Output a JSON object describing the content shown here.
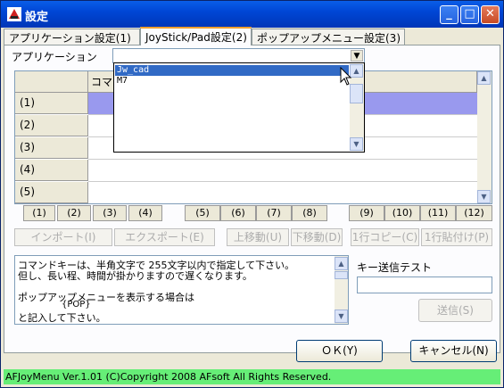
{
  "window": {
    "title": "設定",
    "minimize": "_",
    "maximize": "□",
    "close": "✕"
  },
  "tabs": [
    {
      "label": "アプリケーション設定(1)"
    },
    {
      "label": "JoyStick/Pad設定(2)"
    },
    {
      "label": "ポップアップメニュー設定(3)"
    }
  ],
  "app_label": "アプリケーション",
  "combo": {
    "value": "",
    "options": [
      "Jw_cad",
      "M7"
    ],
    "selected": "Jw_cad"
  },
  "grid": {
    "header": "コマ",
    "rows": [
      "(1)",
      "(2)",
      "(3)",
      "(4)",
      "(5)"
    ]
  },
  "key_buttons": [
    "(1)",
    "(2)",
    "(3)",
    "(4)",
    "(5)",
    "(6)",
    "(7)",
    "(8)",
    "(9)",
    "(10)",
    "(11)",
    "(12)"
  ],
  "action_buttons": [
    "インポート(I)",
    "エクスポート(E)",
    "上移動(U)",
    "下移動(D)",
    "1行コピー(C)",
    "1行貼付け(P)"
  ],
  "memo": {
    "lines": [
      "コマンドキーは、半角文字で 255文字以内で指定して下さい。",
      "但し、長い程、時間が掛かりますので遅くなります。",
      "",
      "ポップアップメニューを表示する場合は",
      "{POP}",
      "と記入して下さい。"
    ]
  },
  "send": {
    "label": "キー送信テスト",
    "value": "",
    "button": "送信(S)"
  },
  "dialog": {
    "ok": "ＯＫ(Y)",
    "cancel": "キャンセル(N)"
  },
  "status": "AFJoyMenu Ver.1.01 (C)Copyright 2008 AFsoft All Rights Reserved."
}
